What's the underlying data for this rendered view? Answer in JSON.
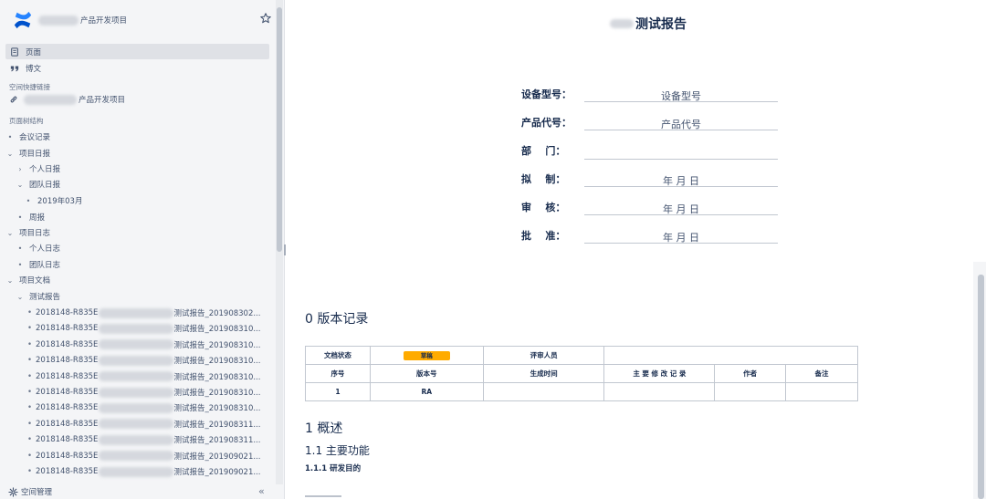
{
  "sidebar": {
    "space_name": "产品开发项目",
    "nav": {
      "pages": "页面",
      "blog": "博文"
    },
    "shortcuts_label": "空间快捷链接",
    "shortcut_link": "产品开发项目",
    "page_tree_label": "页面树结构",
    "tree": [
      {
        "label": "会议记录",
        "marker": "•"
      },
      {
        "label": "项目日报",
        "marker": "⌄"
      },
      {
        "label": "个人日报",
        "marker": "›"
      },
      {
        "label": "团队日报",
        "marker": "⌄"
      },
      {
        "label": "2019年03月",
        "marker": "•"
      },
      {
        "label": "周报",
        "marker": "•"
      },
      {
        "label": "项目日志",
        "marker": "⌄"
      },
      {
        "label": "个人日志",
        "marker": "•"
      },
      {
        "label": "团队日志",
        "marker": "•"
      },
      {
        "label": "项目文档",
        "marker": "⌄"
      },
      {
        "label": "测试报告",
        "marker": "⌄"
      }
    ],
    "report_items": [
      {
        "prefix": "2018148-R835E",
        "suffix": "测试报告_201908302..."
      },
      {
        "prefix": "2018148-R835E",
        "suffix": "测试报告_201908310..."
      },
      {
        "prefix": "2018148-R835E",
        "suffix": "测试报告_201908310..."
      },
      {
        "prefix": "2018148-R835E",
        "suffix": "测试报告_201908310..."
      },
      {
        "prefix": "2018148-R835E",
        "suffix": "测试报告_201908310..."
      },
      {
        "prefix": "2018148-R835E",
        "suffix": "测试报告_201908310..."
      },
      {
        "prefix": "2018148-R835E",
        "suffix": "测试报告_201908310..."
      },
      {
        "prefix": "2018148-R835E",
        "suffix": "测试报告_201908311..."
      },
      {
        "prefix": "2018148-R835E",
        "suffix": "测试报告_201908311..."
      },
      {
        "prefix": "2018148-R835E",
        "suffix": "测试报告_201909021..."
      },
      {
        "prefix": "2018148-R835E",
        "suffix": "测试报告_201909021..."
      }
    ],
    "footer_label": "空间管理",
    "collapse_glyph": "«"
  },
  "page": {
    "title": "测试报告",
    "form": [
      {
        "label": "设备型号：",
        "value": "设备型号"
      },
      {
        "label": "产品代号：",
        "value": "产品代号"
      },
      {
        "label": "部    门：",
        "value": ""
      },
      {
        "label": "拟    制：",
        "value": "年  月  日"
      },
      {
        "label": "审    核：",
        "value": "年  月  日"
      },
      {
        "label": "批    准：",
        "value": "年  月  日"
      }
    ],
    "version_heading": "0 版本记录",
    "version_table": {
      "doc_status_label": "文档状态",
      "doc_status_value": "草稿",
      "reviewer_label": "评审人员",
      "headers": [
        "序号",
        "版本号",
        "生成时间",
        "主 要 修 改 记 录",
        "作者",
        "备注"
      ],
      "rows": [
        [
          "1",
          "RA",
          "",
          "",
          "",
          ""
        ]
      ]
    },
    "h1": "1 概述",
    "h2": "1.1 主要功能",
    "h3": "1.1.1 研发目的"
  }
}
